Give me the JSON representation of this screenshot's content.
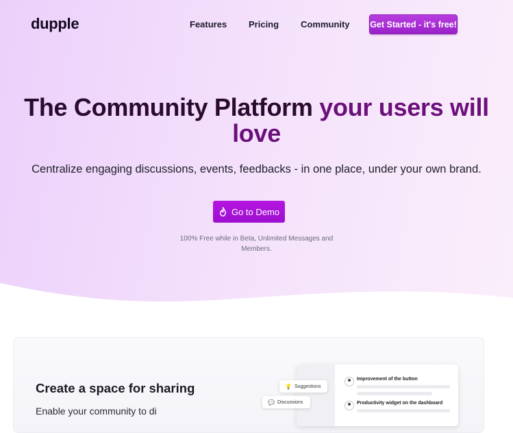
{
  "nav": {
    "logo": "dupple",
    "links": [
      {
        "label": "Features"
      },
      {
        "label": "Pricing"
      },
      {
        "label": "Community"
      }
    ],
    "cta_label": "Get Started - it's free!"
  },
  "hero": {
    "headline_dark": "The Community Platform ",
    "headline_purple": "your users will love",
    "subhead": "Centralize engaging discussions, events, feedbacks - in one place, under your own brand.",
    "demo_button_label": "Go to Demo",
    "note": "100% Free while in Beta, Unlimited Messages and Members."
  },
  "feature": {
    "title": "Create a space for sharing",
    "body_partial": "Enable your community to di",
    "mock": {
      "chips": [
        {
          "label": "Suggestions",
          "icon": "lightbulb-icon"
        },
        {
          "label": "Discussions",
          "icon": "chat-bubble-icon"
        }
      ],
      "posts": [
        {
          "title": "Improvement of the button"
        },
        {
          "title": "Productivity widget on the dashboard"
        }
      ]
    }
  },
  "colors": {
    "brand_purple": "#9d0fd0",
    "headline_dark": "#2a0a2e",
    "headline_purple": "#6b0f7a",
    "hero_gradient_start": "#ecd0fb",
    "hero_gradient_end": "#fbeefb"
  }
}
